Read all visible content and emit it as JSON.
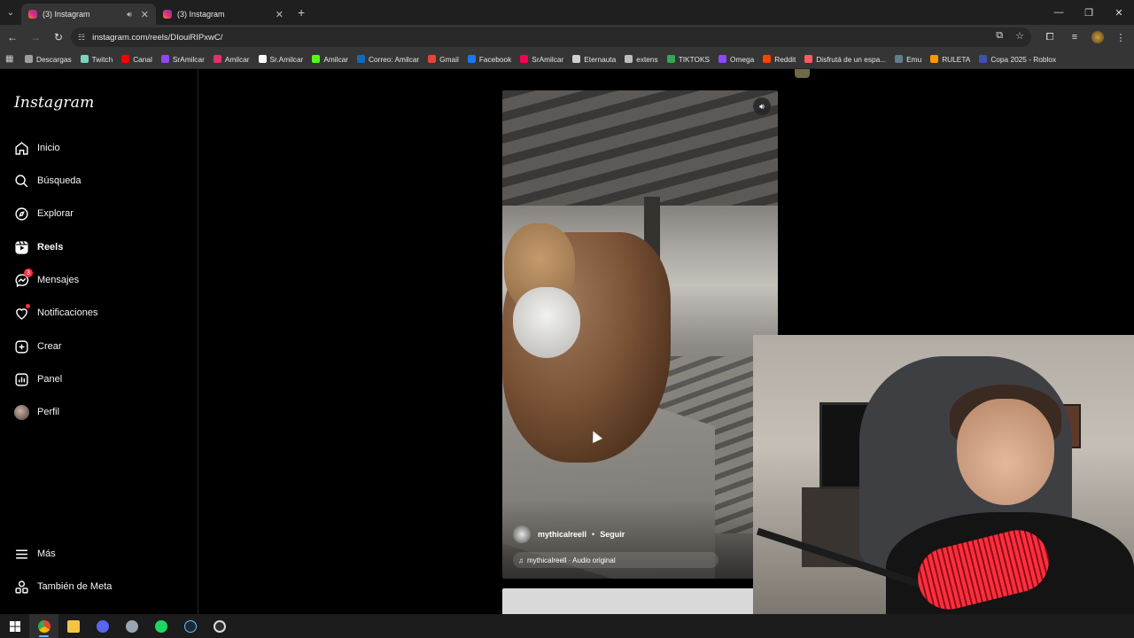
{
  "browser": {
    "tabs": [
      {
        "title": "(3) Instagram",
        "active": true,
        "muted_icon": "speaker-icon"
      },
      {
        "title": "(3) Instagram",
        "active": false
      }
    ],
    "new_tab_symbol": "+",
    "window_controls": [
      "minimize-icon",
      "restore-icon",
      "close-icon"
    ],
    "address": "instagram.com/reels/DIouiRIPxwC/",
    "bookmarks": [
      {
        "label": "Descargas",
        "color": "#9e9e9e"
      },
      {
        "label": "Twitch",
        "color": "#7dd3c0"
      },
      {
        "label": "Canal",
        "color": "#ff0000"
      },
      {
        "label": "SrAmilcar",
        "color": "#9146ff"
      },
      {
        "label": "Amilcar",
        "color": "#e1306c"
      },
      {
        "label": "Sr.Amilcar",
        "color": "#ffffff"
      },
      {
        "label": "Amilcar",
        "color": "#53fc18"
      },
      {
        "label": "Correo: Amilcar",
        "color": "#0f6cbd"
      },
      {
        "label": "Gmail",
        "color": "#ea4335"
      },
      {
        "label": "Facebook",
        "color": "#1877f2"
      },
      {
        "label": "SrAmilcar",
        "color": "#ff0050"
      },
      {
        "label": "Eternauta",
        "color": "#cfcfcf"
      },
      {
        "label": "extens",
        "color": "#bdbdbd"
      },
      {
        "label": "TIKTOKS",
        "color": "#34a853"
      },
      {
        "label": "Omega",
        "color": "#9146ff"
      },
      {
        "label": "Reddit",
        "color": "#ff4500"
      },
      {
        "label": "Disfrutá de un espa...",
        "color": "#ff5a5f"
      },
      {
        "label": "Emu",
        "color": "#607d8b"
      },
      {
        "label": "RULETA",
        "color": "#ff9800"
      },
      {
        "label": "Copa 2025 - Roblox",
        "color": "#3f51b5"
      }
    ]
  },
  "sidebar": {
    "logo": "Instagram",
    "items": [
      {
        "label": "Inicio",
        "icon": "home-icon"
      },
      {
        "label": "Búsqueda",
        "icon": "search-icon"
      },
      {
        "label": "Explorar",
        "icon": "compass-icon"
      },
      {
        "label": "Reels",
        "icon": "reels-icon",
        "selected": true
      },
      {
        "label": "Mensajes",
        "icon": "messenger-icon",
        "badge": "3"
      },
      {
        "label": "Notificaciones",
        "icon": "heart-icon",
        "dot": true
      },
      {
        "label": "Crear",
        "icon": "plus-square-icon"
      },
      {
        "label": "Panel",
        "icon": "chart-icon"
      },
      {
        "label": "Perfil",
        "icon": "avatar"
      }
    ],
    "bottom": [
      {
        "label": "Más",
        "icon": "menu-icon"
      },
      {
        "label": "También de Meta",
        "icon": "meta-icon"
      }
    ]
  },
  "reel": {
    "username": "mythicalreell",
    "separator": "•",
    "follow_label": "Seguir",
    "audio_text": "mythicalreell · Audio original",
    "volume_icon": "volume-icon"
  },
  "colors": {
    "accent_badge": "#ff3040",
    "taskbar_active": "#6fb7ff"
  },
  "taskbar": [
    "windows-start-icon",
    "chrome-icon",
    "file-explorer-icon",
    "discord-icon",
    "app-icon",
    "spotify-icon",
    "steam-icon",
    "obs-icon"
  ]
}
